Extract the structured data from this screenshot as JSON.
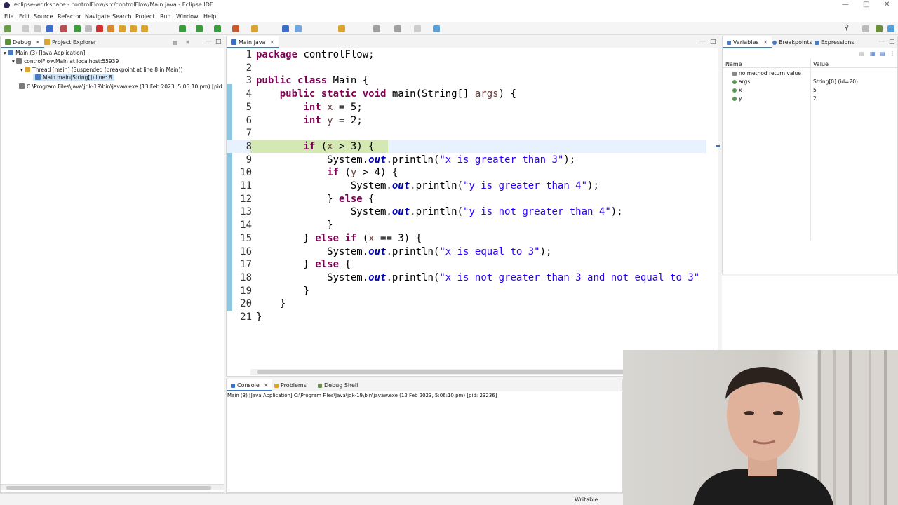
{
  "window": {
    "title": "eclipse-workspace - controlFlow/src/controlFlow/Main.java - Eclipse IDE"
  },
  "menu": [
    "File",
    "Edit",
    "Source",
    "Refactor",
    "Navigate",
    "Search",
    "Project",
    "Run",
    "Window",
    "Help"
  ],
  "debug_view": {
    "tabs": [
      {
        "label": "Debug"
      },
      {
        "label": "Project Explorer"
      }
    ],
    "tree": [
      "Main (3) [Java Application]",
      "controlFlow.Main at localhost:55939",
      "Thread [main] (Suspended (breakpoint at line 8 in Main))",
      "Main.main(String[]) line: 8",
      "C:\\Program Files\\Java\\jdk-19\\bin\\javaw.exe  (13 Feb 2023, 5:06:10 pm) [pid: 23236]"
    ]
  },
  "editor": {
    "tab_label": "Main.java",
    "current_line": 8,
    "lines": [
      "1",
      "2",
      "3",
      "4",
      "5",
      "6",
      "7",
      "8",
      "9",
      "10",
      "11",
      "12",
      "13",
      "14",
      "15",
      "16",
      "17",
      "18",
      "19",
      "20",
      "21"
    ]
  },
  "variables_view": {
    "tabs": [
      "Variables",
      "Breakpoints",
      "Expressions"
    ],
    "columns": [
      "Name",
      "Value"
    ],
    "rows": [
      {
        "name": "no method return value",
        "value": ""
      },
      {
        "name": "args",
        "value": "String[0]  (id=20)"
      },
      {
        "name": "x",
        "value": "5"
      },
      {
        "name": "y",
        "value": "2"
      }
    ]
  },
  "console_view": {
    "tabs": [
      "Console",
      "Problems",
      "Debug Shell"
    ],
    "status": "Main (3) [Java Application] C:\\Program Files\\Java\\jdk-19\\bin\\javaw.exe  (13 Feb 2023, 5:06:10 pm) [pid: 23236]"
  },
  "statusbar": {
    "writable": "Writable"
  },
  "colors": {
    "breakpoint_line": "#d4e8b4",
    "keyword": "#7f0055",
    "string": "#2a00ff",
    "field": "#0000c0",
    "accent": "#3c7bc6"
  }
}
